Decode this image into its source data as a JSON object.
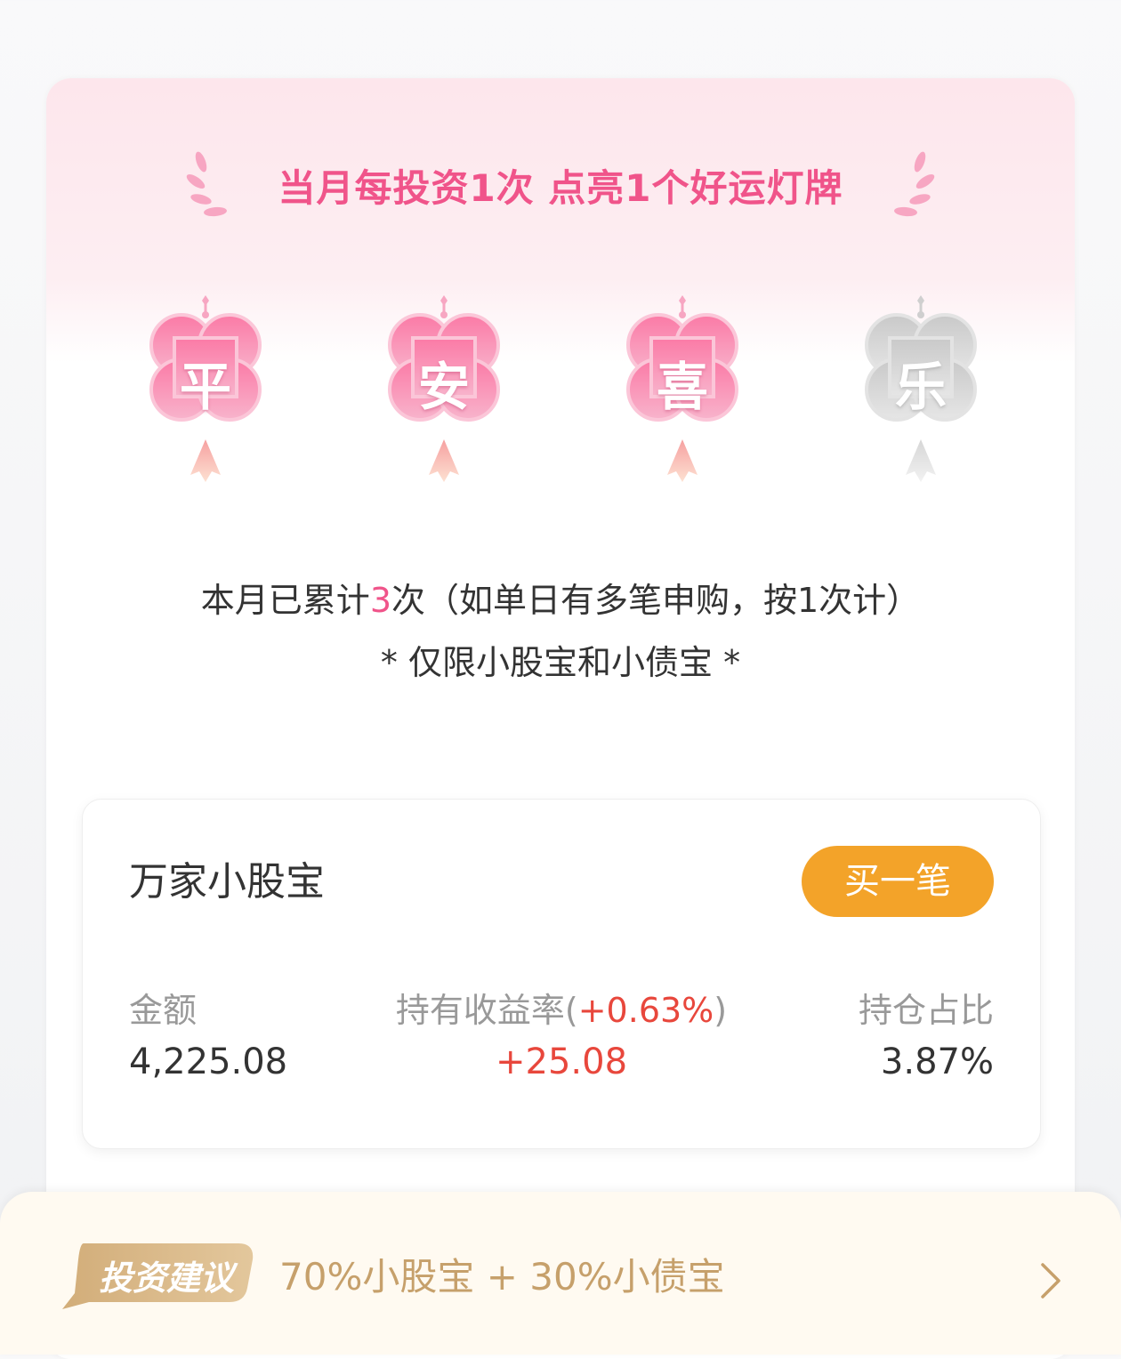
{
  "banner": {
    "headline": "当月每投资1次 点亮1个好运灯牌",
    "lanterns": [
      {
        "char": "平",
        "lit": true
      },
      {
        "char": "安",
        "lit": true
      },
      {
        "char": "喜",
        "lit": true
      },
      {
        "char": "乐",
        "lit": false
      }
    ],
    "count_prefix": "本月已累计",
    "count_value": "3",
    "count_suffix": "次（如单日有多笔申购，按1次计）",
    "note": "* 仅限小股宝和小债宝 *"
  },
  "fund": {
    "name": "万家小股宝",
    "buy_label": "买一笔",
    "amount_label": "金额",
    "amount_value": "4,225.08",
    "yield_label": "持有收益率(",
    "yield_rate": "+0.63%",
    "yield_close": ")",
    "yield_value": "+25.08",
    "share_label": "持仓占比",
    "share_value": "3.87%"
  },
  "advice": {
    "badge": "投资建议",
    "text": "70%小股宝 + 30%小债宝"
  },
  "colors": {
    "accent_pink": "#f0548a",
    "button_orange": "#f3a329",
    "gain_red": "#e8473c",
    "advice_gold": "#c6a06b"
  }
}
